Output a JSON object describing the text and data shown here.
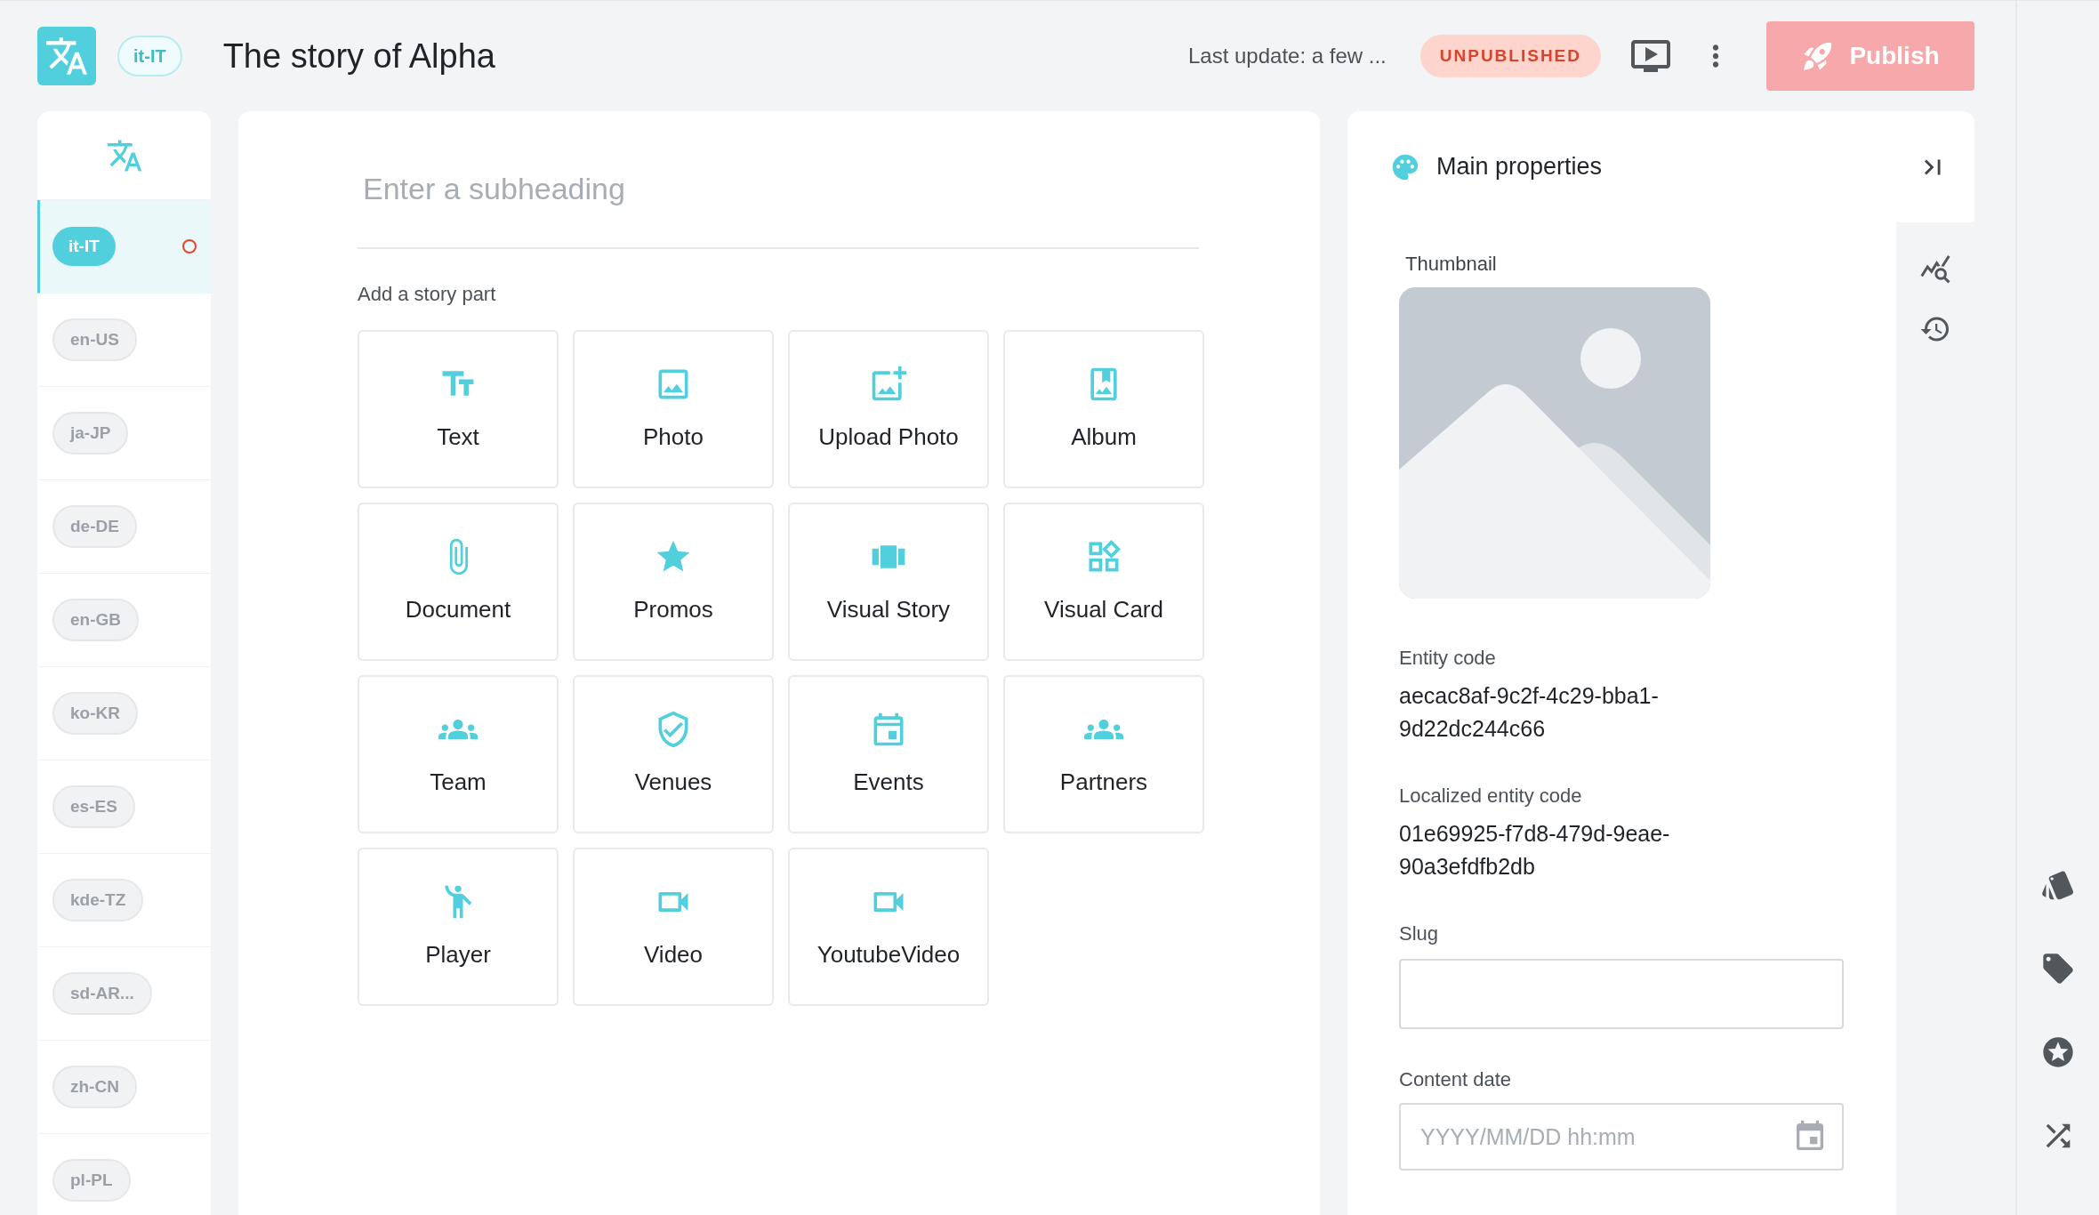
{
  "header": {
    "locale": "it-IT",
    "title": "The story of Alpha",
    "last_update": "Last update: a few ...",
    "status": "UNPUBLISHED",
    "publish": "Publish"
  },
  "locales": [
    {
      "label": "it-IT",
      "selected": true,
      "flagged": true
    },
    {
      "label": "en-US",
      "selected": false,
      "flagged": false
    },
    {
      "label": "ja-JP",
      "selected": false,
      "flagged": false
    },
    {
      "label": "de-DE",
      "selected": false,
      "flagged": false
    },
    {
      "label": "en-GB",
      "selected": false,
      "flagged": false
    },
    {
      "label": "ko-KR",
      "selected": false,
      "flagged": false
    },
    {
      "label": "es-ES",
      "selected": false,
      "flagged": false
    },
    {
      "label": "kde-TZ",
      "selected": false,
      "flagged": false
    },
    {
      "label": "sd-AR...",
      "selected": false,
      "flagged": false
    },
    {
      "label": "zh-CN",
      "selected": false,
      "flagged": false
    },
    {
      "label": "pl-PL",
      "selected": false,
      "flagged": false
    }
  ],
  "editor": {
    "subheading_placeholder": "Enter a subheading",
    "add_part_label": "Add a story part",
    "parts": [
      {
        "kind": "text",
        "label": "Text"
      },
      {
        "label": "Photo"
      },
      {
        "kind": "upload",
        "label": "Upload Photo"
      },
      {
        "kind": "album",
        "label": "Album"
      },
      {
        "kind": "document",
        "label": "Document"
      },
      {
        "kind": "promos",
        "label": "Promos"
      },
      {
        "kind": "visualstory",
        "label": "Visual Story"
      },
      {
        "kind": "visualcard",
        "label": "Visual Card"
      },
      {
        "kind": "team",
        "label": "Team"
      },
      {
        "kind": "venues",
        "label": "Venues"
      },
      {
        "kind": "events",
        "label": "Events"
      },
      {
        "kind": "partners",
        "label": "Partners"
      },
      {
        "kind": "player",
        "label": "Player"
      },
      {
        "kind": "video",
        "label": "Video"
      },
      {
        "kind": "video",
        "label": "YoutubeVideo"
      }
    ]
  },
  "properties": {
    "title": "Main properties",
    "thumbnail_label": "Thumbnail",
    "fields": [
      {
        "label": "Entity code",
        "value": "aecac8af-9c2f-4c29-bba1-9d22dc244c66"
      },
      {
        "label": "Localized entity code",
        "value": "01e69925-f7d8-479d-9eae-90a3efdfb2db"
      }
    ],
    "slug": {
      "label": "Slug"
    },
    "content_date": {
      "label": "Content date",
      "placeholder": "YYYY/MM/DD hh:mm"
    }
  }
}
